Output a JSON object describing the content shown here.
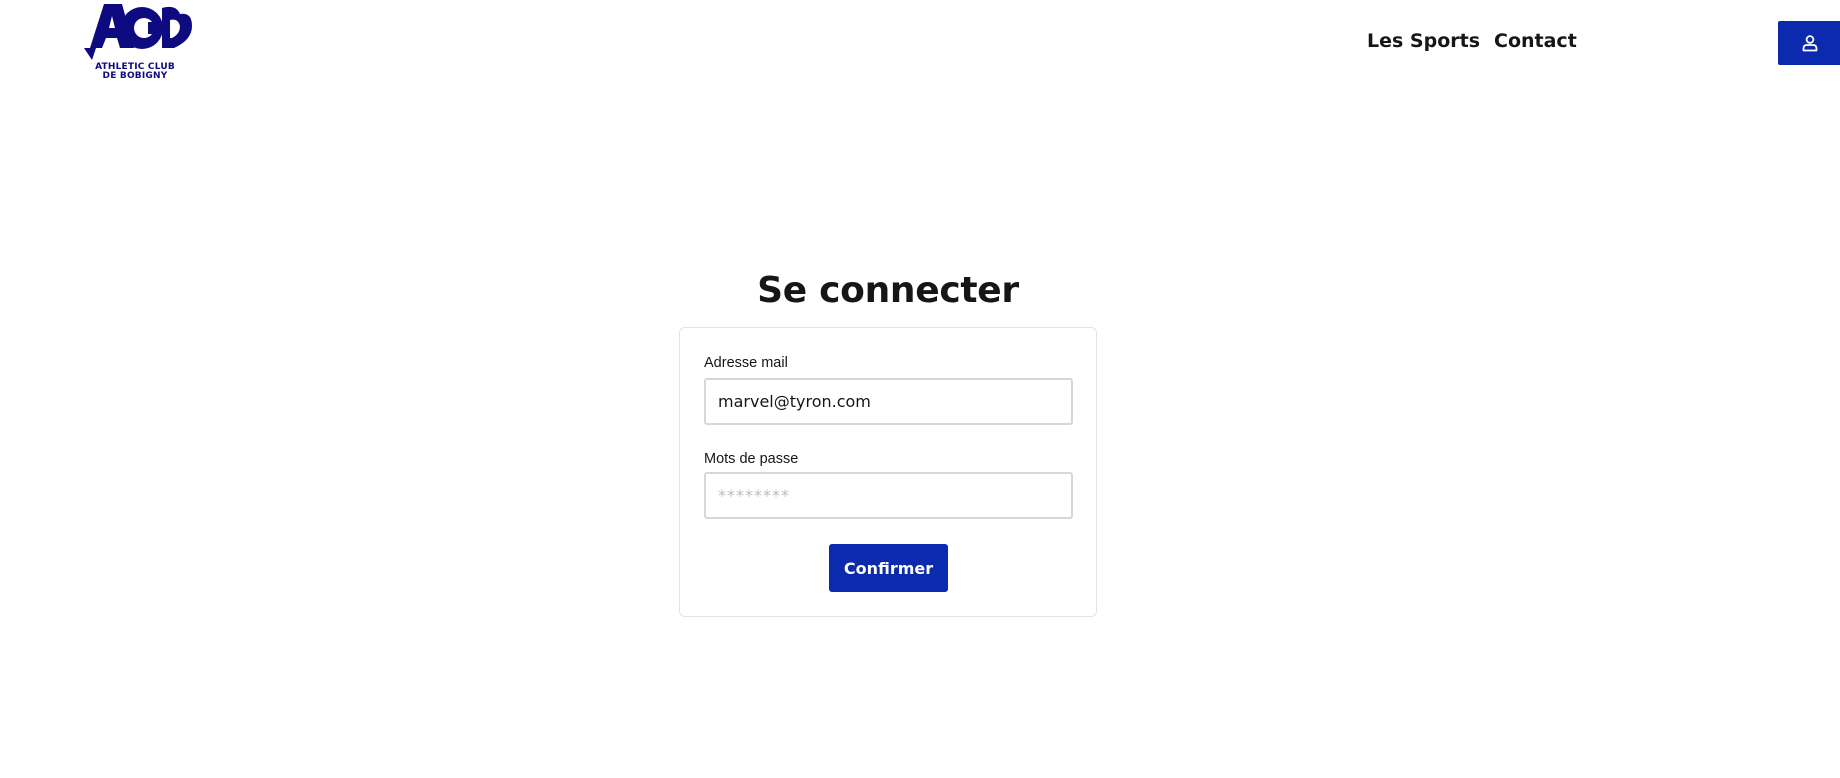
{
  "brand": {
    "logo_icon": "acb-logo-icon",
    "logo_line1": "ATHLETIC CLUB",
    "logo_line2": "DE BOBIGNY",
    "color": "#0e0a80"
  },
  "nav": {
    "items": [
      {
        "label": "Les Sports"
      },
      {
        "label": "Contact"
      }
    ]
  },
  "account_button": {
    "icon": "user-icon",
    "color": "#0b2aad"
  },
  "login": {
    "title": "Se connecter",
    "email_label": "Adresse mail",
    "email_value": "marvel@tyron.com",
    "password_label": "Mots de passe",
    "password_placeholder": "********",
    "submit_label": "Confirmer",
    "accent": "#0b2aad"
  }
}
